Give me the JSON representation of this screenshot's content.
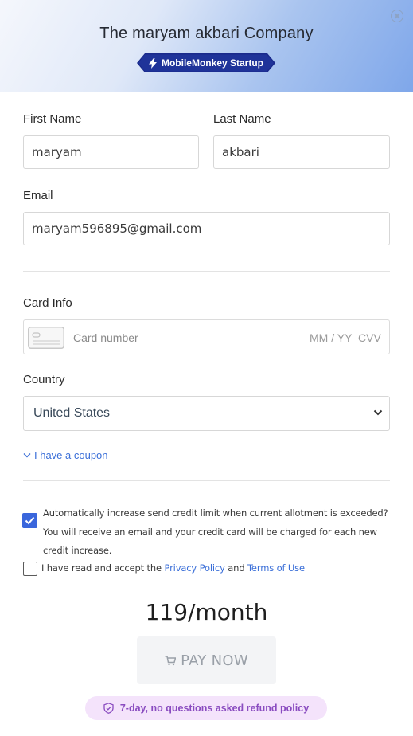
{
  "header": {
    "company_title": "The maryam akbari Company",
    "badge_label": "MobileMonkey Startup",
    "close_icon": "close-circle-icon",
    "badge_color": "#1a2a8c"
  },
  "form": {
    "first_name_label": "First Name",
    "first_name_value": "maryam",
    "last_name_label": "Last Name",
    "last_name_value": "akbari",
    "email_label": "Email",
    "email_value": "maryam596895@gmail.com",
    "card_info_label": "Card Info",
    "card_number_placeholder": "Card number",
    "card_expiry_placeholder": "MM / YY",
    "card_cvv_placeholder": "CVV",
    "country_label": "Country",
    "country_value": "United States",
    "coupon_label": "I have a coupon"
  },
  "consent": {
    "auto_increase_checked": true,
    "auto_increase_text": "Automatically increase send credit limit when current allotment is exceeded? You will receive an email and your credit card will be charged for each new credit increase.",
    "terms_checked": false,
    "terms_prefix": "I have read and accept the",
    "privacy_link": "Privacy Policy",
    "terms_and": "and",
    "terms_link": "Terms of Use"
  },
  "checkout": {
    "price": "119/month",
    "pay_button_label": "PAY NOW",
    "refund_text": "7-day, no questions asked refund policy",
    "accent_color": "#3a66dc",
    "refund_color": "#8a4cc0"
  }
}
